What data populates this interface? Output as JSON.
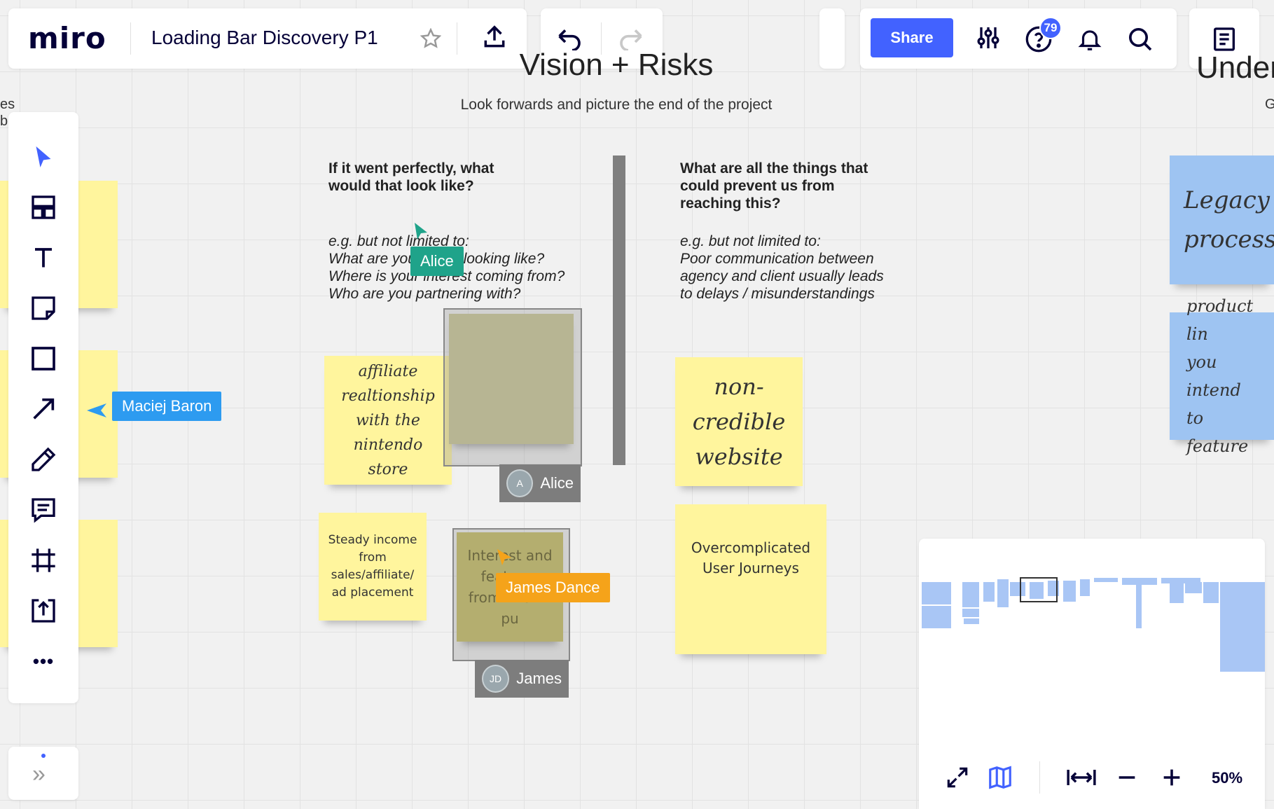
{
  "header": {
    "logo": "miro",
    "board_title": "Loading Bar Discovery P1",
    "share_label": "Share",
    "help_badge": "79"
  },
  "icons": {
    "star": "star-icon",
    "upload": "upload-icon",
    "undo": "undo-icon",
    "redo": "redo-icon",
    "settings": "sliders-icon",
    "help": "help-icon",
    "bell": "bell-icon",
    "search": "search-icon",
    "notes": "notes-icon"
  },
  "canvas": {
    "frame_title": "Vision + Risks",
    "frame_subtitle": "Look forwards and picture the end of the project",
    "right_frame_title": "Under",
    "right_frame_sub": "G",
    "left_frame_text_1": "es",
    "left_frame_text_2": "b",
    "col1_heading": "If it went perfectly, what would that look like?",
    "col1_example_lines": [
      "e.g. but not limited to:",
      "What are your sales looking like?",
      "Where is your interest coming from?",
      "Who are you partnering with?"
    ],
    "col2_heading": "What are all the things that could prevent us from reaching this?",
    "col2_example_lines": [
      "e.g. but not limited to:",
      "Poor communication between",
      "agency and client usually leads",
      "to delays / misunderstandings"
    ]
  },
  "stickies": {
    "affiliate_lines": [
      "affiliate",
      "realtionship",
      "with the",
      "nintendo store"
    ],
    "steady_lines": [
      "Steady income",
      "from",
      "sales/affiliate/",
      "ad placement"
    ],
    "interest_lines": [
      "Interest and",
      "features",
      "from known",
      "pu"
    ],
    "noncred_lines": [
      "non-",
      "credible",
      "website"
    ],
    "overcomp_lines": [
      "Overcomplicated",
      "User Journeys"
    ],
    "legacy_lines": [
      "Legacy",
      "processe"
    ],
    "product_lines": [
      "product lin",
      "you intend",
      "to feature"
    ]
  },
  "collaborators": {
    "alice_cursor": "Alice",
    "maciej_cursor": "Maciej Baron",
    "james_cursor": "James Dance",
    "alice_tag_initial": "A",
    "alice_tag_name": "Alice",
    "james_tag_initial": "JD",
    "james_tag_name": "James"
  },
  "colors": {
    "accent": "#4262ff",
    "alice": "#1fa38a",
    "maciej": "#2d9bf0",
    "james": "#f5a31a",
    "sticky_yellow": "#fff59d",
    "sticky_blue": "#9ec4f2"
  },
  "toolbar": {
    "tools": [
      "select-tool",
      "templates-tool",
      "text-tool",
      "sticky-note-tool",
      "shape-tool",
      "connector-tool",
      "pen-tool",
      "comment-tool",
      "frame-tool",
      "upload-tool",
      "more-tool"
    ],
    "more": "•••"
  },
  "bottom": {
    "expand_label": "»",
    "zoom": "50%"
  }
}
